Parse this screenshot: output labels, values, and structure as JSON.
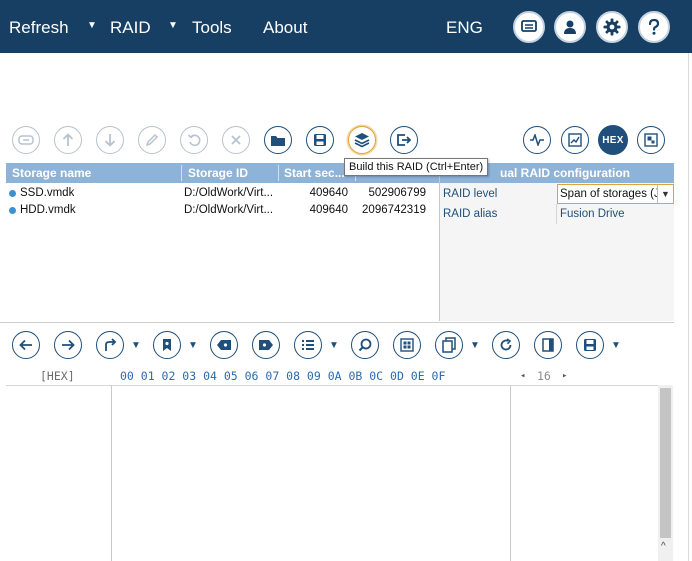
{
  "menu": {
    "refresh": "Refresh",
    "raid": "RAID",
    "tools": "Tools",
    "about": "About",
    "language": "ENG",
    "dropdown_glyph": "▼"
  },
  "top_icons": [
    "monitor-icon",
    "user-icon",
    "gear-icon",
    "help-icon"
  ],
  "toolbar": {
    "buttons": [
      "merge-icon",
      "up-arrow-icon",
      "down-arrow-icon",
      "edit-icon",
      "undo-icon",
      "delete-icon",
      "open-folder-icon",
      "save-icon",
      "build-raid-icon",
      "export-icon",
      "pulse-icon",
      "chart-icon",
      "hex-icon",
      "tile-icon"
    ],
    "hex_label": "HEX",
    "tooltip": "Build this RAID (Ctrl+Enter)"
  },
  "storage_table": {
    "columns": [
      "Storage name",
      "Storage ID",
      "Start sec..."
    ],
    "rows": [
      {
        "name": "SSD.vmdk",
        "id": "D:/OldWork/Virt...",
        "start": "409640",
        "size": "502906799"
      },
      {
        "name": "HDD.vmdk",
        "id": "D:/OldWork/Virt...",
        "start": "409640",
        "size": "2096742319"
      }
    ]
  },
  "raid_config": {
    "title": "ual RAID configuration",
    "level_label": "RAID level",
    "level_value": "Span of storages (J",
    "alias_label": "RAID alias",
    "alias_value": "Fusion Drive"
  },
  "hex_toolbar": {
    "buttons": [
      "back-icon",
      "forward-icon",
      "jump-icon",
      "bookmark-icon",
      "prev-bookmark-icon",
      "next-bookmark-icon",
      "list-icon",
      "search-icon",
      "grid-icon",
      "copy-icon",
      "refresh-icon",
      "panel-icon",
      "save-icon"
    ]
  },
  "hex_view": {
    "offset_label": "[HEX]",
    "columns": "00 01 02 03 04 05 06 07 08 09 0A 0B 0C 0D 0E 0F",
    "width_left": "◂",
    "width_value": "16",
    "width_right": "▸"
  },
  "colors": {
    "topbar": "#163f63",
    "accent": "#1f4f7a",
    "header": "#8eb3d8",
    "highlight": "#e0a33a"
  }
}
